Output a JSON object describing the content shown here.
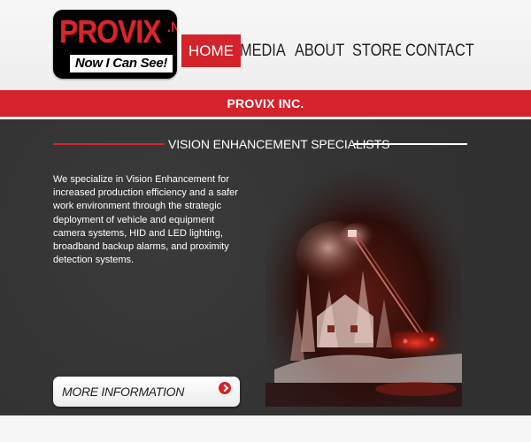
{
  "logo": {
    "name": "PROVIX",
    "tld": ".NET",
    "tagline": "Now I Can See!"
  },
  "nav": {
    "items": [
      {
        "label": "HOME",
        "active": true
      },
      {
        "label": "MEDIA",
        "active": false
      },
      {
        "label": "ABOUT",
        "active": false
      },
      {
        "label": "STORE",
        "active": false
      },
      {
        "label": "CONTACT",
        "active": false
      }
    ]
  },
  "band": {
    "title": "PROVIX INC."
  },
  "section": {
    "title": "VISION ENHANCEMENT SPECIALISTS"
  },
  "intro": {
    "text": "We specialize in Vision Enhancement for increased production efficiency and a safer work environment through the strategic deployment of vehicle and equipment camera systems, HID and LED lighting, broadband backup alarms, and proximity detection systems."
  },
  "cta": {
    "label": "MORE INFORMATION",
    "icon": "arrow-right-circle-icon"
  },
  "photo": {
    "subject": "night-fire-scene-image"
  },
  "colors": {
    "brand_red": "#d4232a",
    "dark_bg": "#353535",
    "logo_bg": "#000000"
  }
}
